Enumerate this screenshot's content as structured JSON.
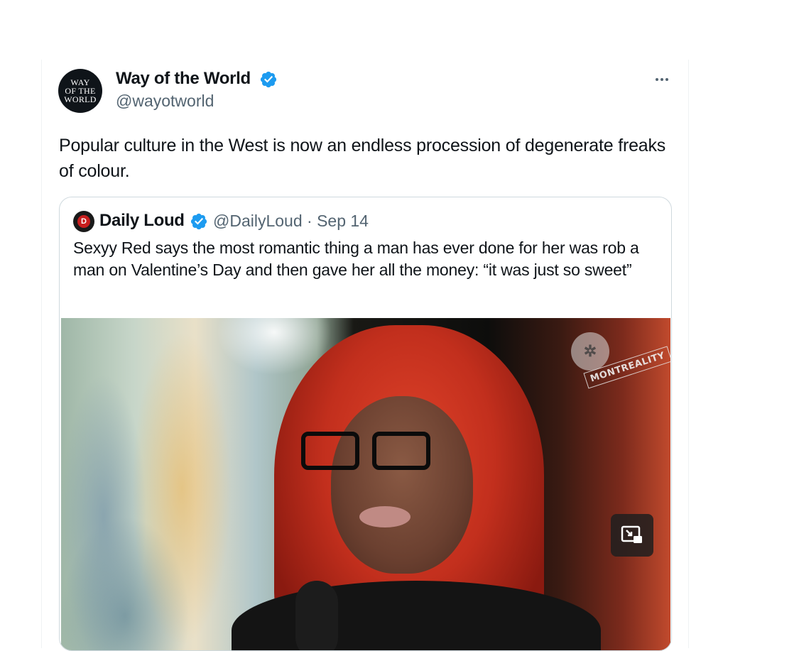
{
  "tweet": {
    "avatar_text": [
      "WAY",
      "OF THE",
      "WORLD"
    ],
    "display_name": "Way of the World",
    "handle": "@wayotworld",
    "text": "Popular culture in the West is now an endless procession of degenerate freaks of colour.",
    "more_icon": "more-horizontal-icon",
    "verified_color": "#1d9bf0"
  },
  "quote": {
    "display_name": "Daily Loud",
    "meta": "@DailyLoud · Sep 14",
    "text": "Sexyy Red says the most romantic thing a man has ever done for her was rob a man on Valentine’s Day and then gave her all the money: “it was just so sweet”",
    "media": {
      "watermark_text": "MONTREALITY",
      "pip_icon": "picture-in-picture-icon"
    }
  }
}
